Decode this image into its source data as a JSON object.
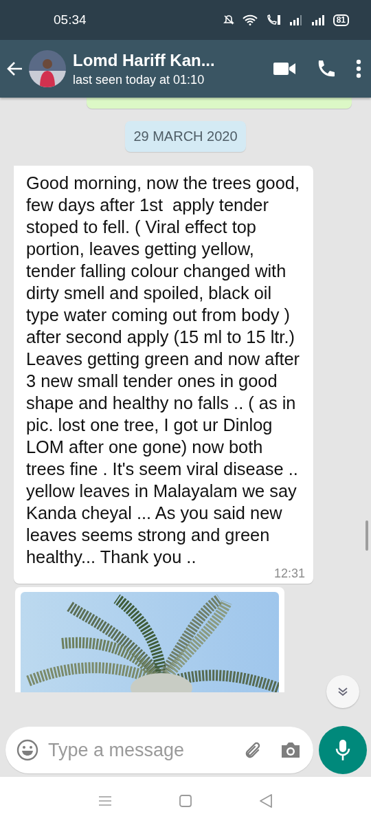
{
  "status_bar": {
    "time": "05:34",
    "battery": "81"
  },
  "header": {
    "contact_name": "Lomd Hariff Kan...",
    "last_seen": "last seen today at 01:10"
  },
  "chat": {
    "date_chip": "29 MARCH 2020",
    "messages": [
      {
        "kind": "outgoing_partial"
      },
      {
        "kind": "text",
        "text": "Good morning, now the trees good, few days after 1st  apply tender stoped to fell. ( Viral effect top portion, leaves getting yellow, tender falling colour changed with dirty smell and spoiled, black oil type water coming out from body ) after second apply (15 ml to 15 ltr.) Leaves getting green and now after 3 new small tender ones in good shape and healthy no falls .. ( as in pic. lost one tree, I got ur Dinlog LOM after one gone) now both trees fine . It's seem viral disease .. yellow leaves in Malayalam we say Kanda cheyal ... As you said new leaves seems strong and green healthy... Thank you ..",
        "time": "12:31"
      },
      {
        "kind": "picture"
      }
    ]
  },
  "composer": {
    "placeholder": "Type a message"
  }
}
